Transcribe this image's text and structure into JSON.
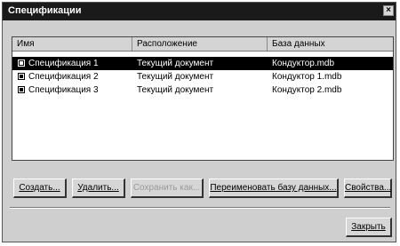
{
  "window": {
    "title": "Спецификации",
    "close_glyph": "×"
  },
  "list": {
    "columns": [
      "Имя",
      "Расположение",
      "База данных"
    ],
    "rows": [
      {
        "name": "Спецификация 1",
        "location": "Текущий документ",
        "database": "Кондуктор.mdb",
        "selected": true
      },
      {
        "name": "Спецификация 2",
        "location": "Текущий документ",
        "database": "Кондуктор 1.mdb",
        "selected": false
      },
      {
        "name": "Спецификация 3",
        "location": "Текущий документ",
        "database": "Кондуктор 2.mdb",
        "selected": false
      }
    ]
  },
  "buttons": {
    "create": "Создать...",
    "delete": "Удалить...",
    "save": "Сохранить как...",
    "rename_db": "Переименовать базу данных...",
    "properties": "Свойства...",
    "close": "Закрыть"
  }
}
